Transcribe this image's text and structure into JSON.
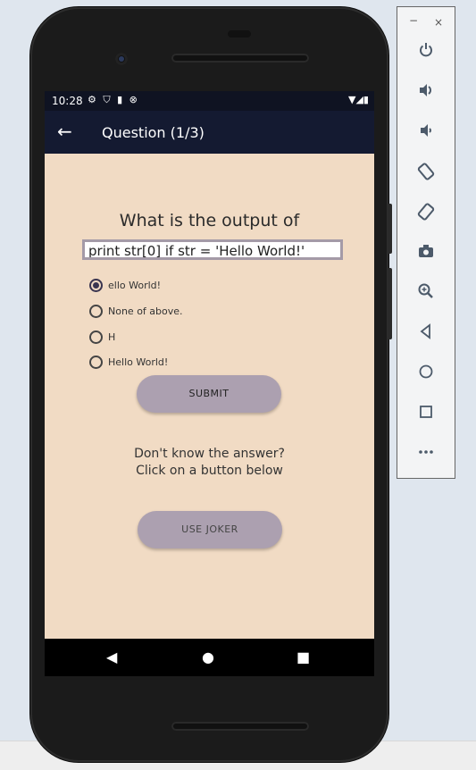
{
  "status": {
    "time": "10:28",
    "left_icons": "⚙ ⛉ ▮ ⊗",
    "right_icons": "▼◢▮"
  },
  "appbar": {
    "title": "Question (1/3)"
  },
  "question": {
    "title": "What is the output of",
    "code": "print str[0] if str = 'Hello World!'"
  },
  "options": [
    {
      "label": "ello World!",
      "checked": true
    },
    {
      "label": "None of above.",
      "checked": false
    },
    {
      "label": "H",
      "checked": false
    },
    {
      "label": "Hello World!",
      "checked": false
    }
  ],
  "buttons": {
    "submit": "SUBMIT",
    "joker": "USE JOKER"
  },
  "hint": {
    "line1": "Don't know the answer?",
    "line2": "Click on a button below"
  },
  "nav": {
    "back": "◀",
    "home": "●",
    "recents": "■"
  },
  "toolbar": {
    "minimize": "−",
    "close": "×",
    "icons": [
      "power-icon",
      "volume-up-icon",
      "volume-down-icon",
      "rotate-left-icon",
      "rotate-right-icon",
      "camera-icon",
      "zoom-icon",
      "back-icon",
      "home-icon",
      "overview-icon",
      "more-icon"
    ]
  },
  "colors": {
    "screen_bg": "#f1dbc4",
    "appbar_bg": "#141a31",
    "pill_bg": "#aca0b0"
  }
}
